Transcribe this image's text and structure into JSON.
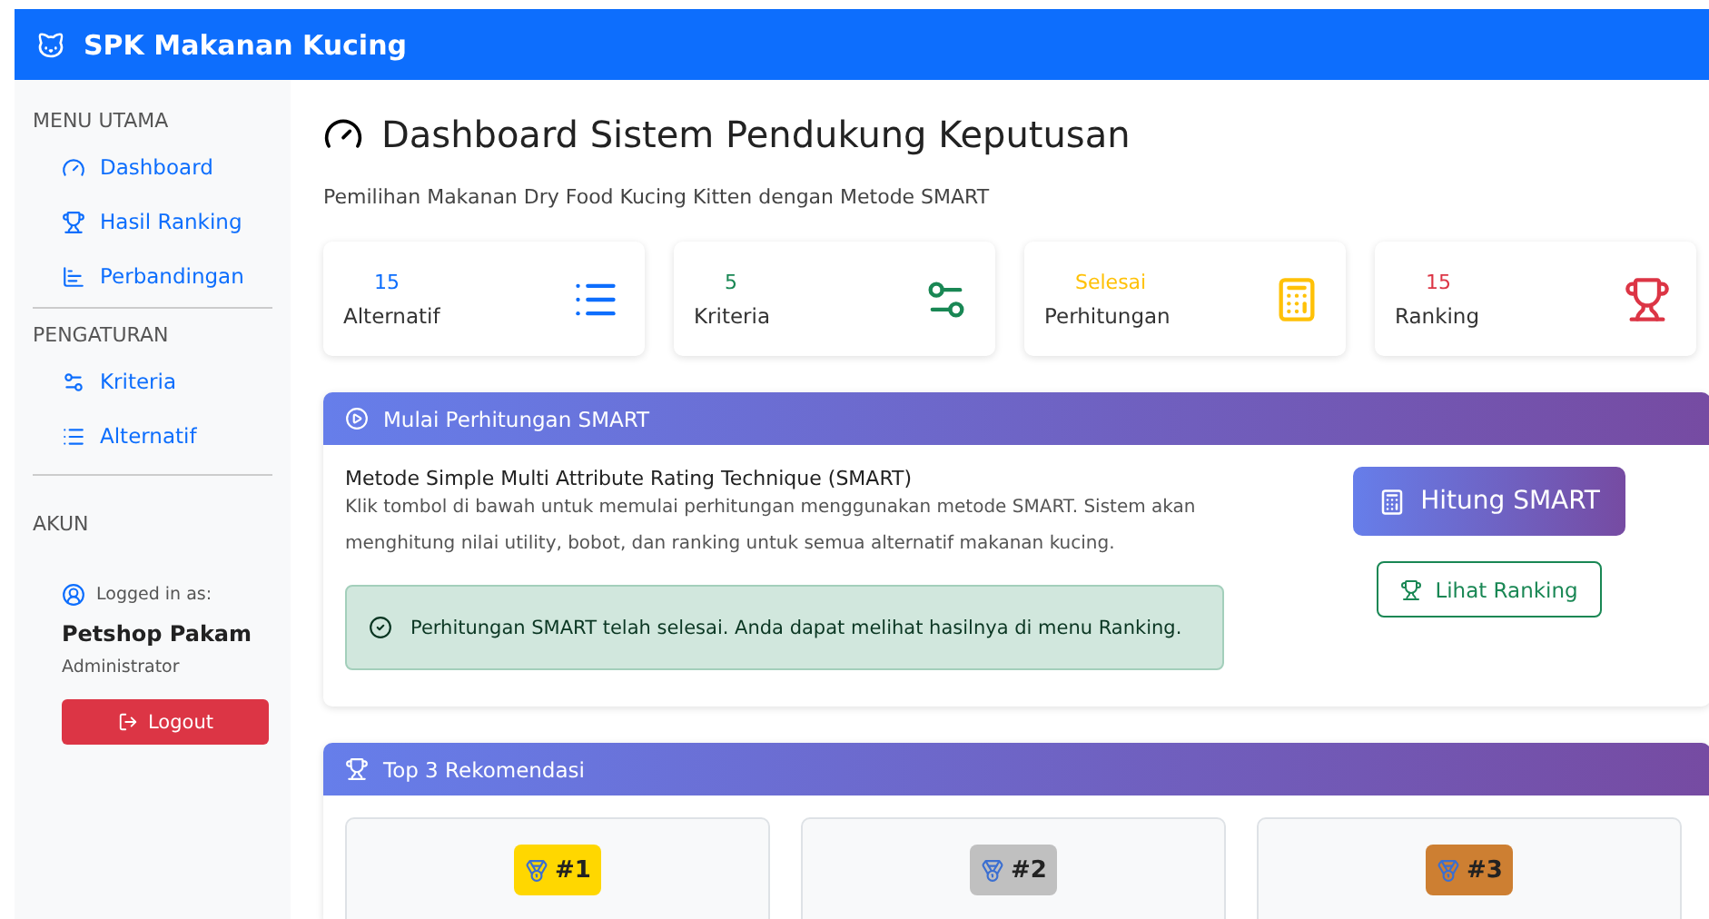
{
  "navbar": {
    "brand": "SPK Makanan Kucing"
  },
  "sidebar": {
    "sections": [
      {
        "heading": "MENU UTAMA",
        "items": [
          {
            "label": "Dashboard"
          },
          {
            "label": "Hasil Ranking"
          },
          {
            "label": "Perbandingan"
          }
        ]
      },
      {
        "heading": "PENGATURAN",
        "items": [
          {
            "label": "Kriteria"
          },
          {
            "label": "Alternatif"
          }
        ]
      }
    ],
    "account": {
      "heading": "AKUN",
      "logged_label": "Logged in as:",
      "user": "Petshop Pakam",
      "role": "Administrator",
      "logout": "Logout"
    }
  },
  "page": {
    "title": "Dashboard Sistem Pendukung Keputusan",
    "subtitle": "Pemilihan Makanan Dry Food Kucing Kitten dengan Metode SMART"
  },
  "stats": [
    {
      "value": "15",
      "label": "Alternatif",
      "color": "#0d6efd"
    },
    {
      "value": "5",
      "label": "Kriteria",
      "color": "#198754"
    },
    {
      "value": "Selesai",
      "label": "Perhitungan",
      "color": "#ffc107"
    },
    {
      "value": "15",
      "label": "Ranking",
      "color": "#dc3545"
    }
  ],
  "smart_card": {
    "header": "Mulai Perhitungan SMART",
    "title": "Metode Simple Multi Attribute Rating Technique (SMART)",
    "description": "Klik tombol di bawah untuk memulai perhitungan menggunakan metode SMART. Sistem akan menghitung nilai utility, bobot, dan ranking untuk semua alternatif makanan kucing.",
    "alert": "Perhitungan SMART telah selesai. Anda dapat melihat hasilnya di menu Ranking.",
    "primary_button": "Hitung SMART",
    "secondary_button": "Lihat Ranking"
  },
  "top3": {
    "header": "Top 3 Rekomendasi",
    "items": [
      {
        "rank": "#1",
        "color": "#ffd700"
      },
      {
        "rank": "#2",
        "color": "#c0c0c0"
      },
      {
        "rank": "#3",
        "color": "#cd7f32"
      }
    ]
  }
}
